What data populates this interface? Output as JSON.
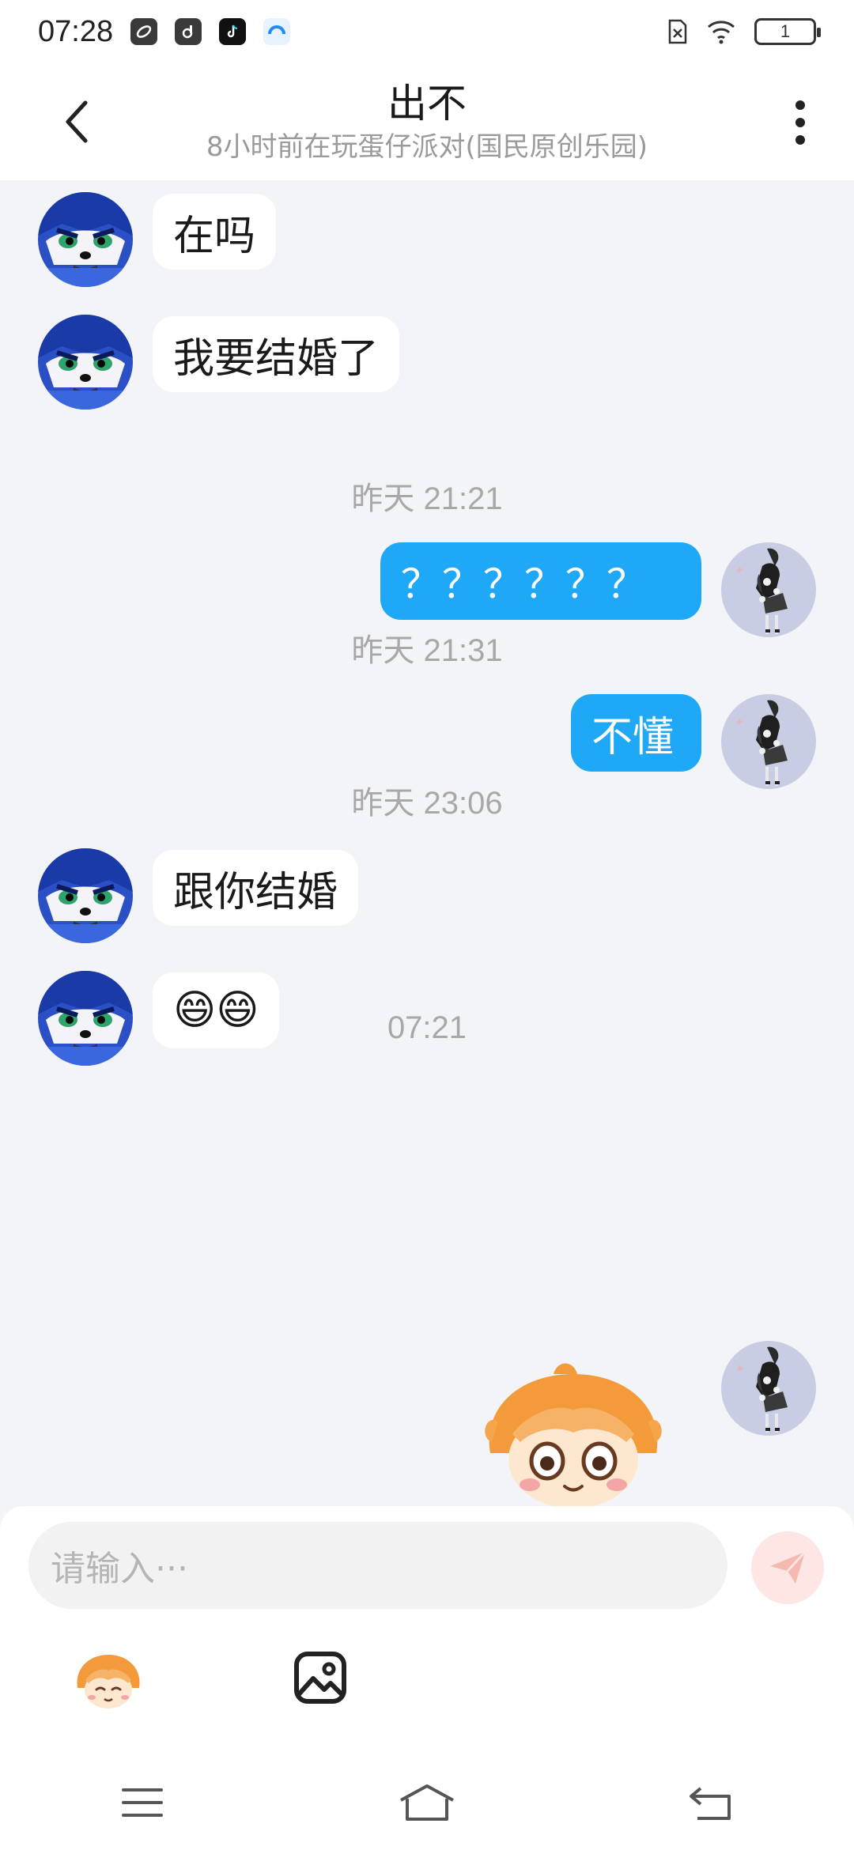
{
  "status_bar": {
    "time": "07:28",
    "apps": [
      "link-app-icon",
      "music-app-icon",
      "tiktok-icon",
      "browser-app-icon"
    ],
    "battery": "1"
  },
  "header": {
    "title": "出不",
    "subtitle": "8小时前在玩蛋仔派对(国民原创乐园)"
  },
  "messages": {
    "m1": "在吗",
    "m2": "我要结婚了",
    "ts1": "昨天 21:21",
    "m3": "？？？？？？",
    "ts2": "昨天 21:31",
    "m4": "不懂",
    "ts3": "昨天 23:06",
    "m5": "跟你结婚",
    "m6": "😄😄",
    "ts4": "07:21"
  },
  "input": {
    "placeholder": "请输入···"
  },
  "colors": {
    "accent": "#1fa8f5",
    "background": "#f2f4f8",
    "send_disabled": "#fde6e3"
  }
}
